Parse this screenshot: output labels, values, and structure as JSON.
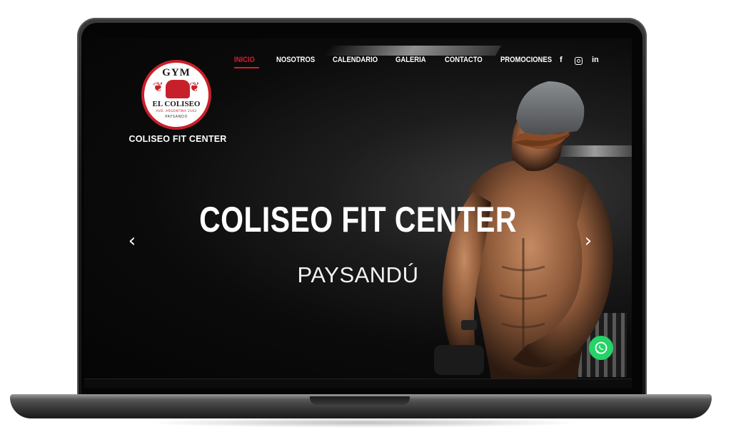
{
  "header": {
    "logo": {
      "top_text": "GYM",
      "name": "EL COLISEO",
      "small_text": "AVD. ARGENTINA 2162",
      "city": "PAYSANDÚ"
    },
    "brand_name": "COLISEO FIT CENTER"
  },
  "nav": {
    "items": [
      "INICIO",
      "NOSOTROS",
      "CALENDARIO",
      "GALERIA",
      "CONTACTO",
      "PROMOCIONES"
    ],
    "active": "INICIO"
  },
  "social": {
    "facebook": "f",
    "instagram": "instagram-icon",
    "linkedin": "in"
  },
  "hero": {
    "title": "COLISEO FIT CENTER",
    "subtitle": "PAYSANDÚ"
  },
  "slider": {
    "prev_icon": "‹",
    "next_icon": "›"
  },
  "colors": {
    "accent": "#d81e2a",
    "whatsapp": "#25d366",
    "background": "#0b0b0b"
  }
}
